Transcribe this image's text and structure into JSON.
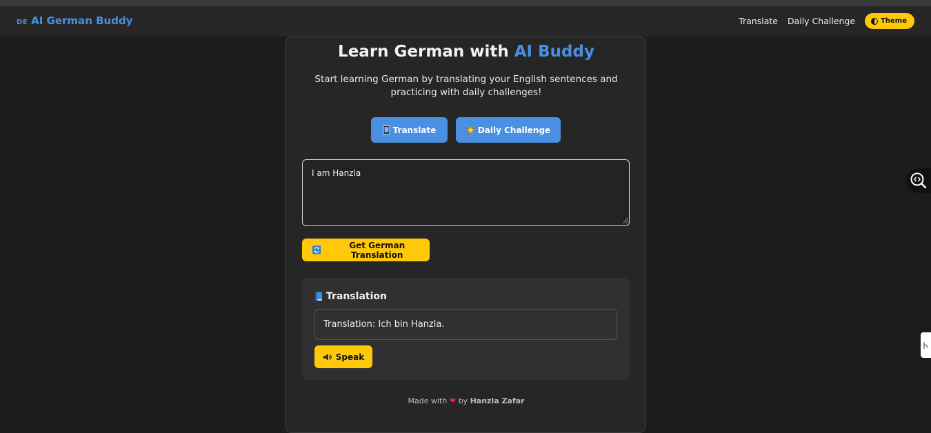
{
  "navbar": {
    "brand_flag": "DE",
    "brand_name": "AI German Buddy",
    "links": [
      "Translate",
      "Daily Challenge"
    ],
    "theme_label": "Theme"
  },
  "hero": {
    "title_main": "Learn German with ",
    "title_accent": "AI Buddy",
    "subtitle": "Start learning German by translating your English sentences and practicing with daily challenges!"
  },
  "tabs": {
    "translate_label": "Translate",
    "challenge_label": "Daily Challenge"
  },
  "input": {
    "value": "I am Hanzla"
  },
  "actions": {
    "get_translation_label": "Get German Translation"
  },
  "result": {
    "heading": "Translation",
    "text": "Translation: Ich bin Hanzla.",
    "speak_label": "Speak"
  },
  "footer": {
    "made_with": "Made with",
    "by": "by",
    "author": "Hanzla Zafar"
  },
  "colors": {
    "accent_blue": "#4a90e2",
    "accent_yellow": "#ffc80a",
    "background": "#1c1c1c",
    "card": "#262626",
    "heart": "#e0245e"
  },
  "icons": {
    "translate_tab": "tablet-icon",
    "challenge_tab": "star-icon",
    "get_translation": "refresh-icon",
    "result_heading": "book-icon",
    "speak": "speaker-icon",
    "theme": "half-circle-icon",
    "side_tool": "code-search-icon"
  }
}
